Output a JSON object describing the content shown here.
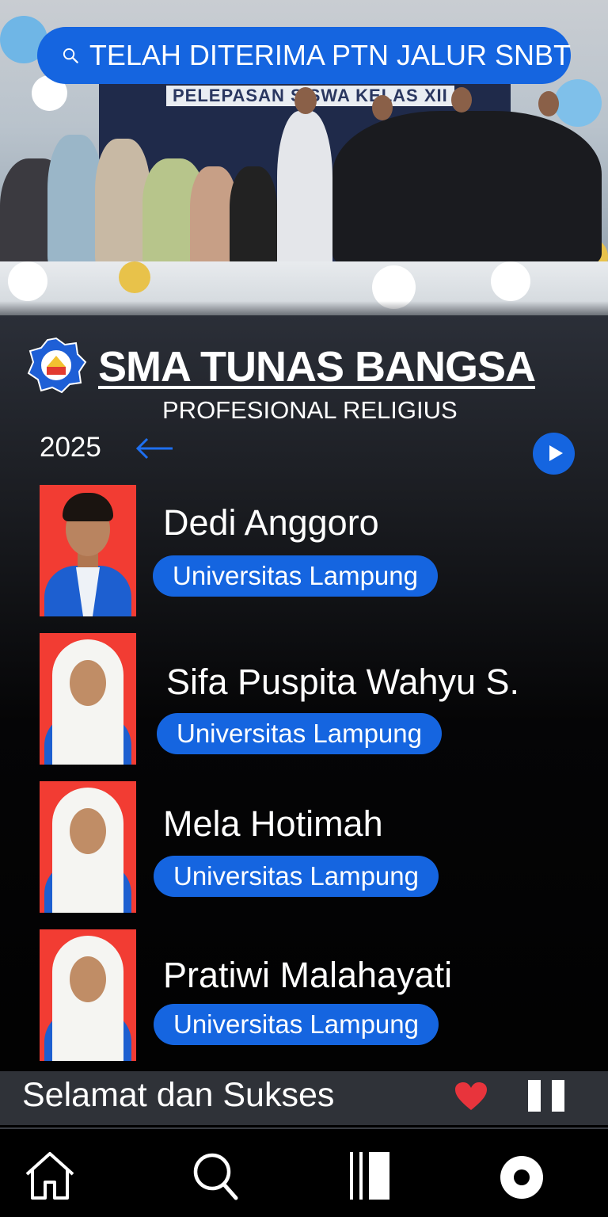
{
  "search": {
    "label": "TELAH DITERIMA PTN JALUR SNBT"
  },
  "hero": {
    "banner_text": "PELEPASAN SISWA KELAS XII"
  },
  "school": {
    "name": "SMA TUNAS BANGSA",
    "motto": "PROFESIONAL RELIGIUS"
  },
  "year": "2025",
  "students": [
    {
      "name": "Dedi Anggoro",
      "university": "Universitas Lampung"
    },
    {
      "name": "Sifa Puspita Wahyu S.",
      "university": "Universitas Lampung"
    },
    {
      "name": "Mela Hotimah",
      "university": "Universitas Lampung"
    },
    {
      "name": "Pratiwi Malahayati",
      "university": "Universitas Lampung"
    }
  ],
  "now_playing": {
    "text": "Selamat dan Sukses"
  },
  "icons": {
    "search": "search-icon",
    "back": "arrow-left-icon",
    "play": "play-icon",
    "heart": "heart-icon",
    "pause": "pause-icon",
    "home": "home-icon",
    "nav_search": "search-icon",
    "library": "library-icon",
    "profile": "profile-icon"
  },
  "colors": {
    "accent": "#1565e0",
    "photo_bg": "#f23c33",
    "heart": "#e8343c",
    "bar": "#2f3238"
  }
}
